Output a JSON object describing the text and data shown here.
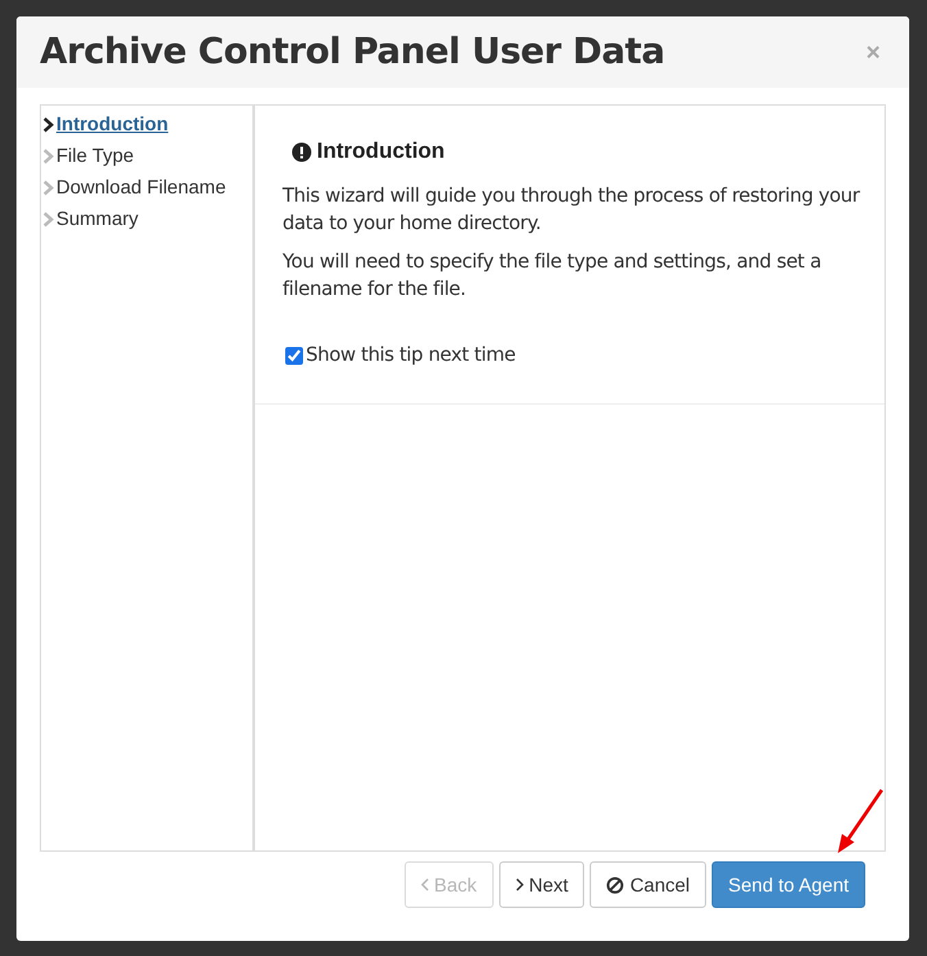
{
  "dialog": {
    "title": "Archive Control Panel User Data",
    "close": "×"
  },
  "steps": [
    {
      "label": "Introduction",
      "selected": true
    },
    {
      "label": "File Type",
      "selected": false
    },
    {
      "label": "Download Filename",
      "selected": false
    },
    {
      "label": "Summary",
      "selected": false
    }
  ],
  "content": {
    "heading": "Introduction",
    "paragraphs": [
      "This wizard will guide you through the process of restoring your data to your home directory.",
      "You will need to specify the file type and settings, and set a filename for the file."
    ],
    "tip": {
      "label": "Show this tip next time",
      "checked": true
    }
  },
  "buttons": [
    {
      "label": "Back",
      "kind": "back",
      "disabled": true
    },
    {
      "label": "Next",
      "kind": "next",
      "disabled": false
    },
    {
      "label": "Cancel",
      "kind": "cancel",
      "disabled": false
    },
    {
      "label": "Send to Agent",
      "kind": "primary",
      "disabled": false
    }
  ]
}
